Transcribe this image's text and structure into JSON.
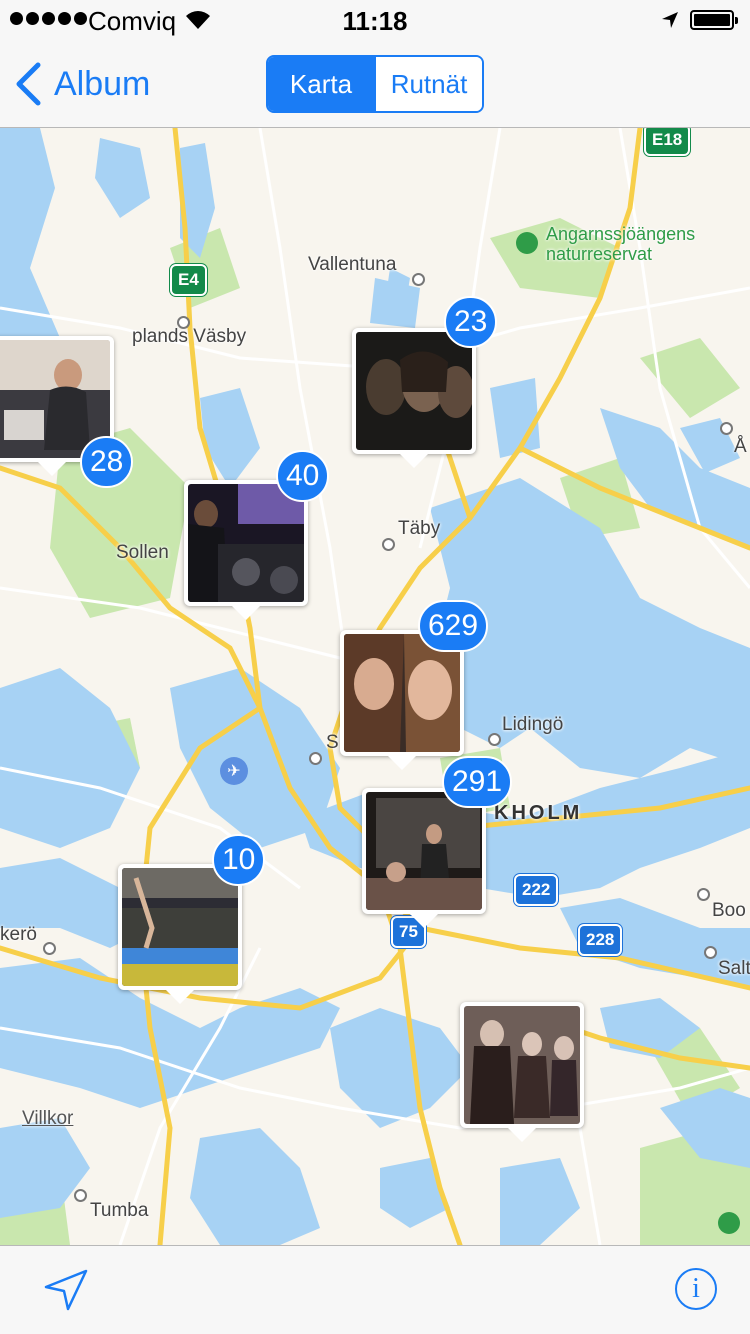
{
  "status_bar": {
    "carrier": "Comviq",
    "time": "11:18",
    "icons": [
      "signal-dots-icon",
      "wifi-icon",
      "location-arrow-icon",
      "battery-icon"
    ]
  },
  "nav": {
    "back_label": "Album",
    "segments": [
      "Karta",
      "Rutnät"
    ],
    "selected_segment": "Karta"
  },
  "map": {
    "place_labels": {
      "vallentuna": "Vallentuna",
      "upplands_vasby": "plands Väsby",
      "taby": "Täby",
      "sollentuna": "Sollen",
      "lidingo": "Lidingö",
      "s": "S",
      "stockholm": "KHOLM",
      "kero": "kerö",
      "boo": "Boo",
      "salt": "Salt",
      "tumba": "Tumba",
      "a_edge": "Å",
      "park": "Angarnssjöängens naturreserv at",
      "park_line1": "Angarnssjöängens",
      "park_line2": "naturreservat"
    },
    "legal_link": "Villkor",
    "road_shields": {
      "e18": "E18",
      "e4": "E4",
      "r222": "222",
      "r228": "228",
      "r75": "75"
    },
    "photo_pins": [
      {
        "count": "28"
      },
      {
        "count": "23"
      },
      {
        "count": "40"
      },
      {
        "count": "629"
      },
      {
        "count": "291"
      },
      {
        "count": "10"
      },
      {
        "count": ""
      }
    ],
    "colors": {
      "water": "#a7d2f4",
      "land": "#f8f5ee",
      "park": "#c9e7ae",
      "road_major": "#f7cf4a",
      "road_minor": "#ffffff",
      "badge": "#1a7cf5"
    }
  },
  "toolbar": {
    "left_icon": "location-arrow-icon",
    "right_icon": "info-icon",
    "info_glyph": "i"
  }
}
